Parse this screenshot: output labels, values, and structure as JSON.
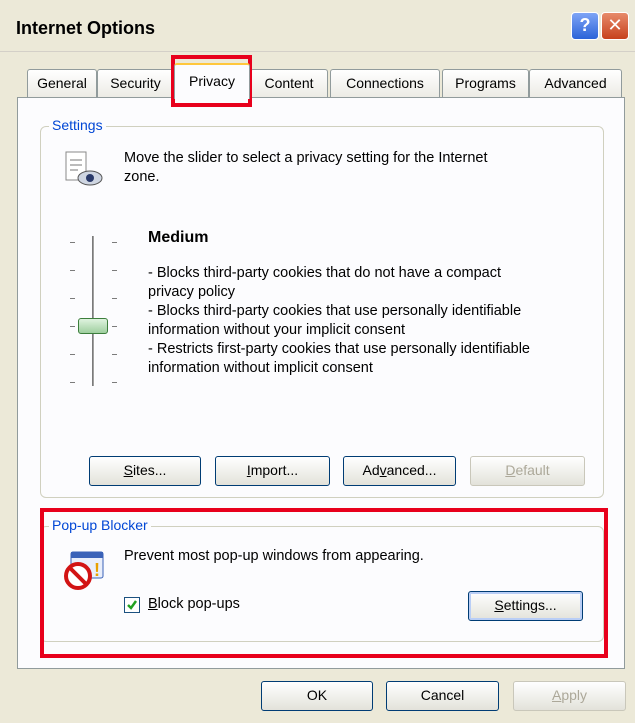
{
  "window": {
    "title": "Internet Options",
    "help_label": "?",
    "close_label": "✕"
  },
  "tabs": [
    {
      "label": "General"
    },
    {
      "label": "Security"
    },
    {
      "label": "Privacy"
    },
    {
      "label": "Content"
    },
    {
      "label": "Connections"
    },
    {
      "label": "Programs"
    },
    {
      "label": "Advanced"
    }
  ],
  "active_tab": "Privacy",
  "settings": {
    "group_label": "Settings",
    "instruction_line1": "Move the slider to select a privacy setting for the Internet",
    "instruction_line2": "zone.",
    "level_title": "Medium",
    "description_lines": [
      "- Blocks third-party cookies that do not have a compact",
      "privacy policy",
      "- Blocks third-party cookies that use personally identifiable",
      "information without your implicit consent",
      "- Restricts first-party cookies that use personally identifiable",
      "information without implicit consent"
    ],
    "slider_level": 3,
    "slider_levels_total": 6,
    "buttons": {
      "sites_pre": "",
      "sites_u": "S",
      "sites_post": "ites...",
      "import_pre": "",
      "import_u": "I",
      "import_post": "mport...",
      "advanced_pre": "Ad",
      "advanced_u": "v",
      "advanced_post": "anced...",
      "default_pre": "",
      "default_u": "D",
      "default_post": "efault"
    }
  },
  "popup_blocker": {
    "group_label": "Pop-up Blocker",
    "description": "Prevent most pop-up windows from appearing.",
    "checkbox_u": "B",
    "checkbox_post": "lock pop-ups",
    "checkbox_checked": true,
    "settings_pre": "",
    "settings_u": "S",
    "settings_post": "ettings..."
  },
  "dialog_buttons": {
    "ok": "OK",
    "cancel": "Cancel",
    "apply_u": "A",
    "apply_post": "pply"
  },
  "colors": {
    "highlight": "#e8001c",
    "group_label": "#0046d5",
    "tab_accent": "#ffc73c"
  }
}
